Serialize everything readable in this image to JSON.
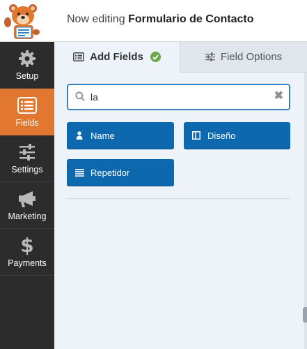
{
  "header": {
    "prefix": "Now editing",
    "form_name": "Formulario de Contacto"
  },
  "sidebar": {
    "logo_icon": "bear-mascot-icon",
    "items": [
      {
        "label": "Setup",
        "icon": "gear-icon"
      },
      {
        "label": "Fields",
        "icon": "fields-list-icon",
        "active": true
      },
      {
        "label": "Settings",
        "icon": "sliders-icon"
      },
      {
        "label": "Marketing",
        "icon": "megaphone-icon"
      },
      {
        "label": "Payments",
        "icon": "dollar-icon"
      }
    ]
  },
  "tabs": {
    "add_fields": "Add Fields",
    "field_options": "Field Options"
  },
  "search": {
    "value": "la",
    "clear": "✖"
  },
  "fields": {
    "name": "Name",
    "diseno": "Diseño",
    "repetidor": "Repetidor"
  },
  "colors": {
    "sidebar_bg": "#2c2c2c",
    "active_orange": "#e27730",
    "button_blue": "#0e68ad",
    "panel_bg": "#eef3fa",
    "search_border": "#3582c4",
    "check_green": "#6aa74f"
  }
}
